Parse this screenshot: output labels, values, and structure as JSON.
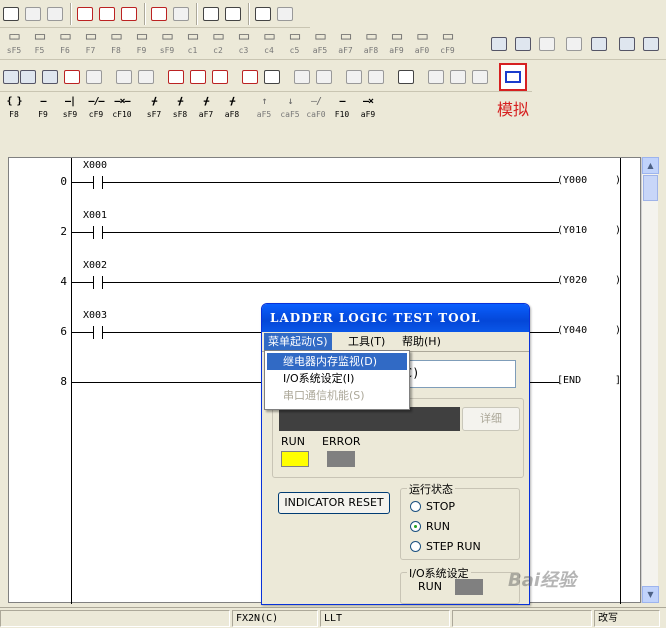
{
  "toolbar": {
    "row2_keys": [
      "sF5",
      "F5",
      "F6",
      "F7",
      "F8",
      "F9",
      "sF9",
      "c1",
      "c2",
      "c3",
      "c4",
      "c5",
      "aF5",
      "aF7",
      "aF8",
      "aF9",
      "aF0",
      "cF9"
    ],
    "row4_keys": [
      "F8",
      "F9",
      "sF9",
      "cF9",
      "cF10",
      "sF7",
      "sF8",
      "aF7",
      "aF8",
      "aF5",
      "caF5",
      "caF0",
      "F10",
      "aF9"
    ]
  },
  "callout": {
    "label": "模拟"
  },
  "ladder": {
    "rungs": [
      {
        "step": "0",
        "contact": "X000",
        "coil": "Y000"
      },
      {
        "step": "2",
        "contact": "X001",
        "coil": "Y010"
      },
      {
        "step": "4",
        "contact": "X002",
        "coil": "Y020"
      },
      {
        "step": "6",
        "contact": "X003",
        "coil": "Y040"
      },
      {
        "step": "8",
        "contact": "",
        "coil": "END"
      }
    ]
  },
  "statusbar": {
    "plc_type": "FX2N(C)",
    "mode": "LLT",
    "edit_mode": "改写"
  },
  "dialog": {
    "title": "LADDER LOGIC TEST TOOL",
    "menu": {
      "start": "菜单起动(S)",
      "tools": "工具(T)",
      "help": "帮助(H)"
    },
    "dropdown": [
      {
        "label": "继电器内存监视(D)",
        "state": "selected"
      },
      {
        "label": "I/O系统设定(I)",
        "state": "normal"
      },
      {
        "label": "串口通信机能(S)",
        "state": "disabled"
      }
    ],
    "plc_field_tail": "C)",
    "detail_button": "详细",
    "run_label": "RUN",
    "error_label": "ERROR",
    "run_color": "#ffff00",
    "error_color": "#808080",
    "indicator_reset": "INDICATOR RESET",
    "run_state_group": "运行状态",
    "run_options": [
      "STOP",
      "RUN",
      "STEP RUN"
    ],
    "selected_option": "RUN",
    "io_group": "I/O系统设定",
    "io_run_label": "RUN"
  },
  "watermark": "Bai经验"
}
